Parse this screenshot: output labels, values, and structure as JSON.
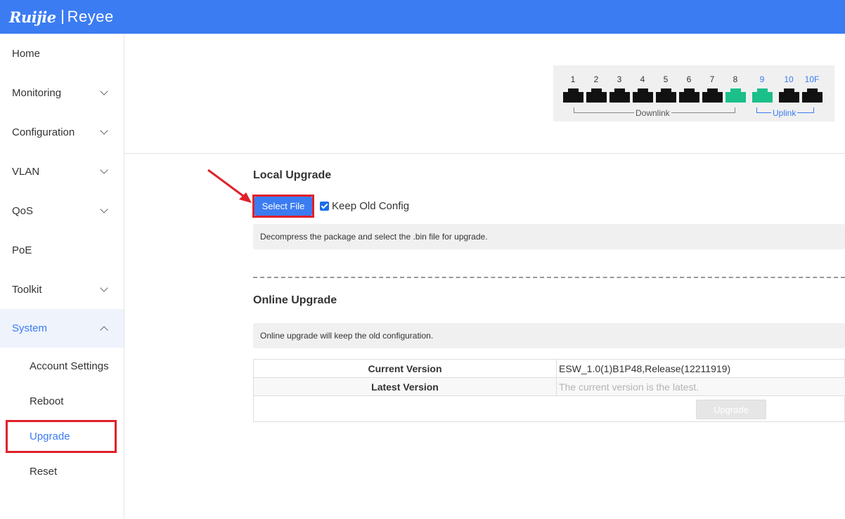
{
  "header": {
    "brand": "Ruijie",
    "sub_brand": "Reyee"
  },
  "sidebar": {
    "items": [
      {
        "label": "Home"
      },
      {
        "label": "Monitoring"
      },
      {
        "label": "Configuration"
      },
      {
        "label": "VLAN"
      },
      {
        "label": "QoS"
      },
      {
        "label": "PoE"
      },
      {
        "label": "Toolkit"
      },
      {
        "label": "System"
      }
    ],
    "system_sub": [
      {
        "label": "Account Settings"
      },
      {
        "label": "Reboot"
      },
      {
        "label": "Upgrade"
      },
      {
        "label": "Reset"
      }
    ]
  },
  "ports": {
    "numbers": [
      "1",
      "2",
      "3",
      "4",
      "5",
      "6",
      "7",
      "8",
      "9",
      "10",
      "10F"
    ],
    "status": [
      "down",
      "down",
      "down",
      "down",
      "down",
      "down",
      "down",
      "up",
      "up",
      "down",
      "down"
    ],
    "downlink_label": "Downlink",
    "uplink_label": "Uplink",
    "colors": {
      "up": "#1bbf8a",
      "down": "#111111",
      "uplink_text": "#3b7cf2"
    }
  },
  "local_upgrade": {
    "title": "Local Upgrade",
    "select_file_label": "Select File",
    "keep_old_config_label": "Keep Old Config",
    "keep_old_config_checked": true,
    "hint": "Decompress the package and select the .bin file for upgrade."
  },
  "online_upgrade": {
    "title": "Online Upgrade",
    "hint": "Online upgrade will keep the old configuration.",
    "current_version_label": "Current Version",
    "current_version_value": "ESW_1.0(1)B1P48,Release(12211919)",
    "latest_version_label": "Latest Version",
    "latest_version_value": "The current version is the latest.",
    "upgrade_button_label": "Upgrade"
  },
  "theme": {
    "accent": "#3b7cf2",
    "highlight": "#e0202a"
  }
}
